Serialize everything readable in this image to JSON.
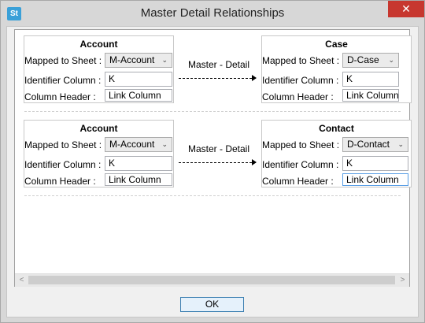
{
  "window": {
    "title": "Master Detail Relationships",
    "app_icon_text": "St",
    "close_symbol": "✕"
  },
  "relationships": [
    {
      "master": {
        "title": "Account",
        "mapped_label": "Mapped to Sheet :",
        "mapped_value": "M-Account",
        "identifier_label": "Identifier Column :",
        "identifier_value": "K",
        "header_label": "Column Header :",
        "header_value": "Link Column"
      },
      "link_label": "Master - Detail",
      "detail": {
        "title": "Case",
        "mapped_label": "Mapped to Sheet :",
        "mapped_value": "D-Case",
        "identifier_label": "Identifier Column :",
        "identifier_value": "K",
        "header_label": "Column Header :",
        "header_value": "Link Column"
      }
    },
    {
      "master": {
        "title": "Account",
        "mapped_label": "Mapped to Sheet :",
        "mapped_value": "M-Account",
        "identifier_label": "Identifier Column :",
        "identifier_value": "K",
        "header_label": "Column Header :",
        "header_value": "Link Column"
      },
      "link_label": "Master - Detail",
      "detail": {
        "title": "Contact",
        "mapped_label": "Mapped to Sheet :",
        "mapped_value": "D-Contact",
        "identifier_label": "Identifier Column :",
        "identifier_value": "K",
        "header_label": "Column Header :",
        "header_value": "Link Column"
      }
    }
  ],
  "scrollbar": {
    "left_arrow": "<",
    "right_arrow": ">"
  },
  "footer": {
    "ok_label": "OK"
  },
  "colors": {
    "close": "#c7372f",
    "accent": "#3c7fb1",
    "focus": "#569de5"
  },
  "icons": [
    "app-icon",
    "close-icon",
    "chevron-down-icon",
    "arrow-right-icon"
  ]
}
